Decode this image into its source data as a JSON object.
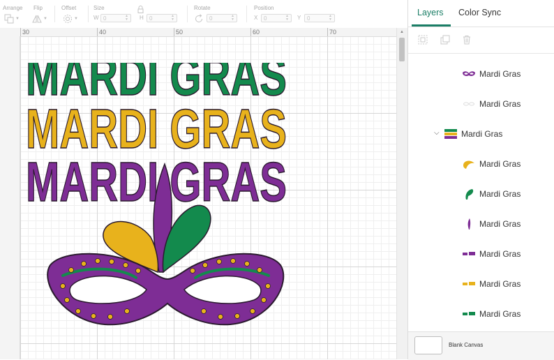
{
  "toolbar": {
    "arrange_label": "Arrange",
    "flip_label": "Flip",
    "offset_label": "Offset",
    "size_label": "Size",
    "size_w_label": "W",
    "size_w_value": "0",
    "size_h_label": "H",
    "size_h_value": "0",
    "rotate_label": "Rotate",
    "rotate_value": "0",
    "position_label": "Position",
    "position_x_label": "X",
    "position_x_value": "0",
    "position_y_label": "Y",
    "position_y_value": "0"
  },
  "ruler": {
    "marks": [
      "30",
      "40",
      "50",
      "60",
      "70"
    ]
  },
  "canvas": {
    "design_text": "MARDI GRAS",
    "colors": {
      "green": "#138a4d",
      "gold": "#e8b21c",
      "purple": "#7e2d95",
      "outline": "#2a1a2e"
    }
  },
  "panel": {
    "tabs": [
      {
        "label": "Layers",
        "active": true
      },
      {
        "label": "Color Sync",
        "active": false
      }
    ],
    "accent": "#1b7e66",
    "layers": [
      {
        "name": "Mardi Gras",
        "icon": "mask-thumbnail-icon",
        "indent": 1
      },
      {
        "name": "Mardi Gras",
        "icon": "mask-outline-thumbnail-icon",
        "indent": 1
      },
      {
        "name": "Mardi Gras",
        "icon": "group-thumbnail-icon",
        "indent": 0
      },
      {
        "name": "Mardi Gras",
        "icon": "gold-feather-thumbnail-icon",
        "indent": 1
      },
      {
        "name": "Mardi Gras",
        "icon": "green-feather-thumbnail-icon",
        "indent": 1
      },
      {
        "name": "Mardi Gras",
        "icon": "purple-feather-thumbnail-icon",
        "indent": 1
      },
      {
        "name": "Mardi Gras",
        "icon": "purple-text-thumbnail-icon",
        "indent": 1
      },
      {
        "name": "Mardi Gras",
        "icon": "gold-text-thumbnail-icon",
        "indent": 1
      },
      {
        "name": "Mardi Gras",
        "icon": "green-text-thumbnail-icon",
        "indent": 1
      }
    ],
    "blank_canvas_label": "Blank Canvas"
  }
}
